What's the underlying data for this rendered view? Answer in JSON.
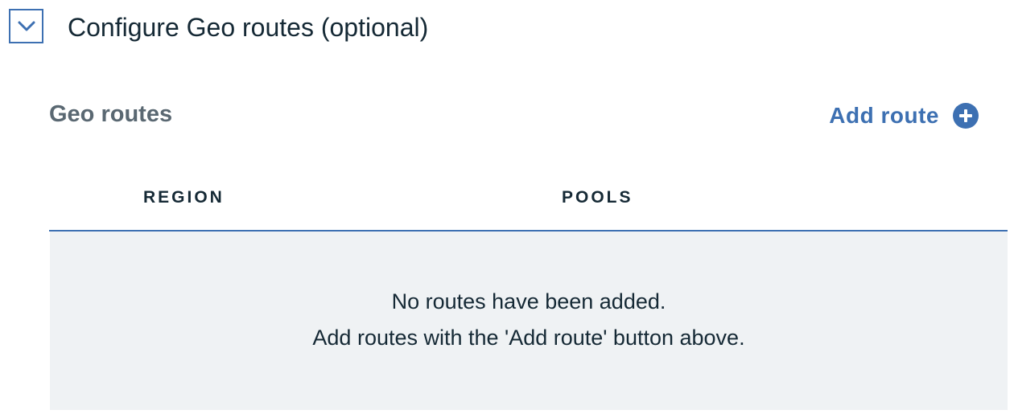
{
  "section": {
    "title": "Configure Geo routes (optional)",
    "expanded": true,
    "toggle_icon": "chevron-down-icon"
  },
  "geo_routes": {
    "heading": "Geo routes",
    "add_button_label": "Add route",
    "add_button_icon": "plus-circle-icon",
    "accent_color": "#3d70b2"
  },
  "table": {
    "columns": [
      "REGION",
      "POOLS"
    ],
    "rows": [],
    "empty_message": [
      "No routes have been added.",
      "Add routes with the 'Add route' button above."
    ],
    "empty_background": "#eff2f4"
  }
}
